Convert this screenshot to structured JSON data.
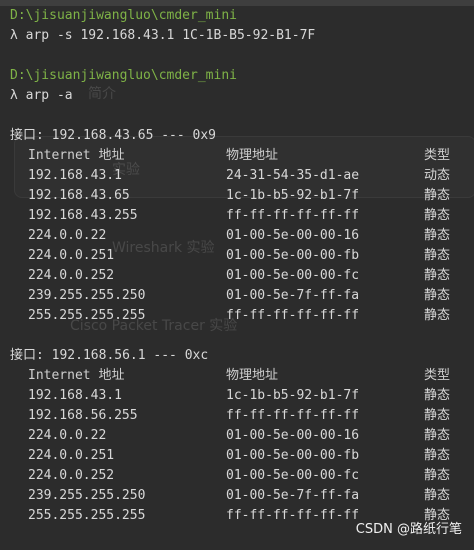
{
  "session1": {
    "cwd": "D:\\jisuanjiwangluo\\cmder_mini",
    "prompt": "λ",
    "command": "arp -s 192.168.43.1 1C-1B-B5-92-B1-7F"
  },
  "session2": {
    "cwd": "D:\\jisuanjiwangluo\\cmder_mini",
    "prompt": "λ",
    "command": "arp -a"
  },
  "ghost": {
    "item1": "简介",
    "item2": "实验",
    "item3": "Wireshark 实验",
    "item4": "Cisco Packet Tracer 实验"
  },
  "interfaces": [
    {
      "title": "接口: 192.168.43.65 --- 0x9",
      "headers": {
        "ip": "Internet 地址",
        "mac": "物理地址",
        "type": "类型"
      },
      "rows": [
        {
          "ip": "192.168.43.1",
          "mac": "24-31-54-35-d1-ae",
          "type": "动态"
        },
        {
          "ip": "192.168.43.65",
          "mac": "1c-1b-b5-92-b1-7f",
          "type": "静态"
        },
        {
          "ip": "192.168.43.255",
          "mac": "ff-ff-ff-ff-ff-ff",
          "type": "静态"
        },
        {
          "ip": "224.0.0.22",
          "mac": "01-00-5e-00-00-16",
          "type": "静态"
        },
        {
          "ip": "224.0.0.251",
          "mac": "01-00-5e-00-00-fb",
          "type": "静态"
        },
        {
          "ip": "224.0.0.252",
          "mac": "01-00-5e-00-00-fc",
          "type": "静态"
        },
        {
          "ip": "239.255.255.250",
          "mac": "01-00-5e-7f-ff-fa",
          "type": "静态"
        },
        {
          "ip": "255.255.255.255",
          "mac": "ff-ff-ff-ff-ff-ff",
          "type": "静态"
        }
      ]
    },
    {
      "title": "接口: 192.168.56.1 --- 0xc",
      "headers": {
        "ip": "Internet 地址",
        "mac": "物理地址",
        "type": "类型"
      },
      "rows": [
        {
          "ip": "192.168.43.1",
          "mac": "1c-1b-b5-92-b1-7f",
          "type": "静态"
        },
        {
          "ip": "192.168.56.255",
          "mac": "ff-ff-ff-ff-ff-ff",
          "type": "静态"
        },
        {
          "ip": "224.0.0.22",
          "mac": "01-00-5e-00-00-16",
          "type": "静态"
        },
        {
          "ip": "224.0.0.251",
          "mac": "01-00-5e-00-00-fb",
          "type": "静态"
        },
        {
          "ip": "224.0.0.252",
          "mac": "01-00-5e-00-00-fc",
          "type": "静态"
        },
        {
          "ip": "239.255.255.250",
          "mac": "01-00-5e-7f-ff-fa",
          "type": "静态"
        },
        {
          "ip": "255.255.255.255",
          "mac": "ff-ff-ff-ff-ff-ff",
          "type": "静态"
        }
      ]
    }
  ],
  "watermark": "CSDN @路纸行笔"
}
